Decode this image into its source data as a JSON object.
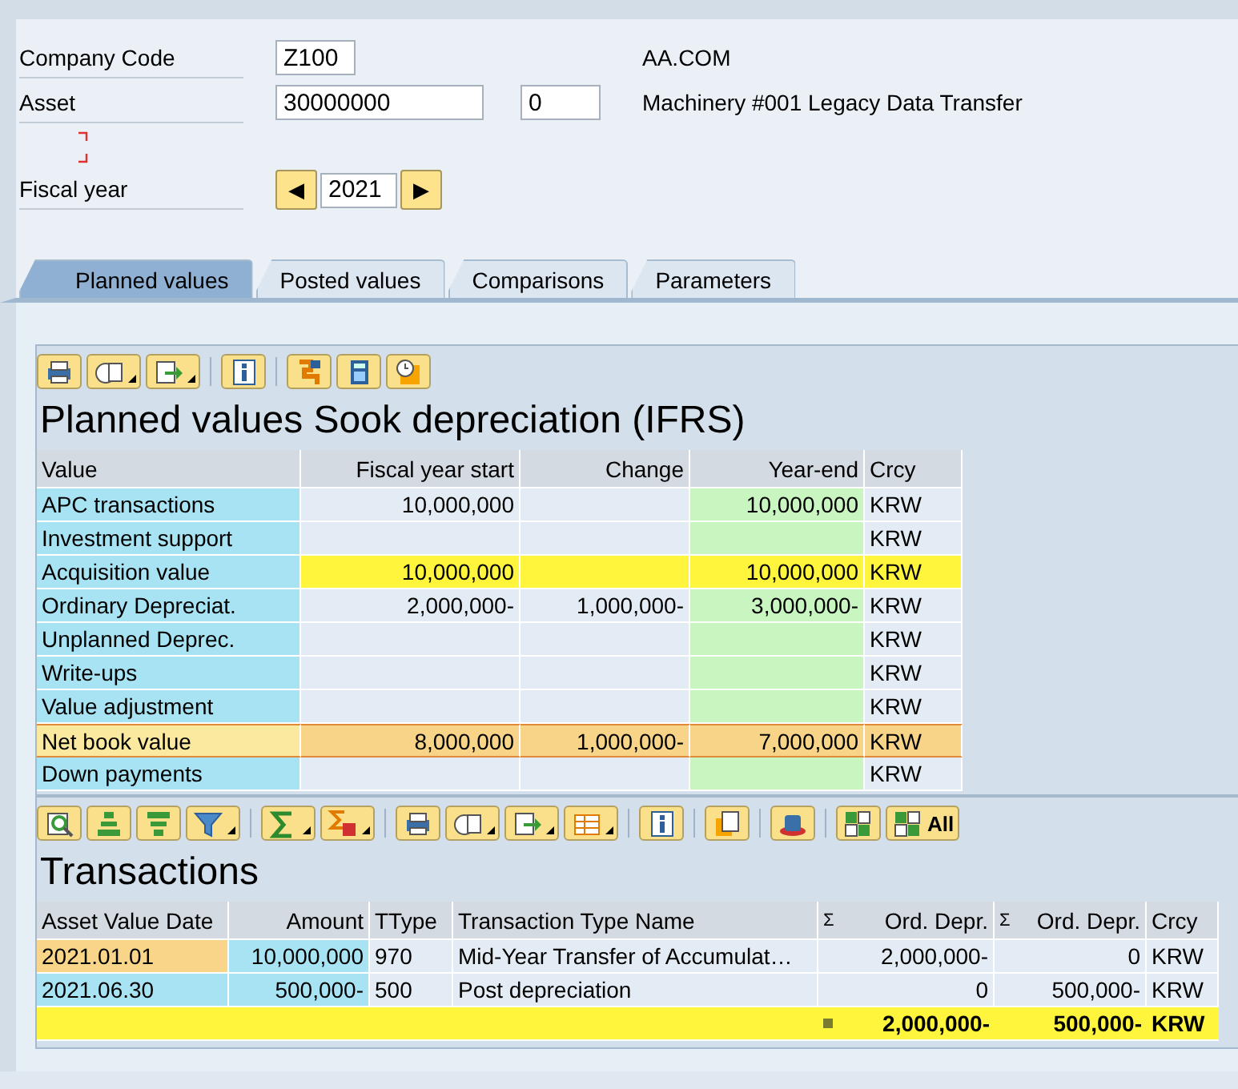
{
  "header": {
    "fields": [
      {
        "label": "Company Code",
        "value": "Z100",
        "text": "AA.COM"
      },
      {
        "label": "Asset",
        "value": "30000000",
        "extra": "0",
        "text": "Machinery #001 Legacy Data Transfer"
      }
    ],
    "fiscal_year": {
      "label": "Fiscal year",
      "prev": "◀",
      "value": "2021",
      "next": "▶"
    }
  },
  "tabs": [
    {
      "label": "Planned values",
      "selected": true
    },
    {
      "label": "Posted values",
      "selected": false
    },
    {
      "label": "Comparisons",
      "selected": false
    },
    {
      "label": "Parameters",
      "selected": false
    }
  ],
  "grids": [
    {
      "toolbar": [
        {
          "kind": "print"
        },
        {
          "kind": "view",
          "dropdown": true
        },
        {
          "kind": "export",
          "dropdown": true
        },
        {
          "kind": "sep"
        },
        {
          "kind": "info"
        },
        {
          "kind": "sep"
        },
        {
          "kind": "chart"
        },
        {
          "kind": "calc"
        },
        {
          "kind": "clock"
        }
      ],
      "title": "Planned values Sook depreciation (IFRS)",
      "columns": [
        {
          "label": "Value",
          "kind": "text"
        },
        {
          "label": "Fiscal year start",
          "kind": "number"
        },
        {
          "label": "Change",
          "kind": "number"
        },
        {
          "label": "Year-end",
          "kind": "number"
        },
        {
          "label": "Crcy",
          "kind": "text"
        }
      ],
      "rows": [
        {
          "kind": "normal",
          "cells": [
            "APC transactions",
            "10,000,000",
            null,
            "10,000,000",
            "KRW"
          ]
        },
        {
          "kind": "normal",
          "cells": [
            "Investment support",
            null,
            null,
            null,
            "KRW"
          ]
        },
        {
          "kind": "highlight",
          "cells": [
            "Acquisition value",
            "10,000,000",
            null,
            "10,000,000",
            "KRW"
          ]
        },
        {
          "kind": "normal",
          "cells": [
            "Ordinary Depreciat.",
            "2,000,000-",
            "1,000,000-",
            "3,000,000-",
            "KRW"
          ]
        },
        {
          "kind": "normal",
          "cells": [
            "Unplanned Deprec.",
            null,
            null,
            null,
            "KRW"
          ]
        },
        {
          "kind": "normal",
          "cells": [
            "Write-ups",
            null,
            null,
            null,
            "KRW"
          ]
        },
        {
          "kind": "normal",
          "cells": [
            "Value adjustment",
            null,
            null,
            null,
            "KRW"
          ]
        },
        {
          "kind": "total",
          "cells": [
            "Net book value",
            "8,000,000",
            "1,000,000-",
            "7,000,000",
            "KRW"
          ]
        },
        {
          "kind": "normal",
          "cells": [
            "Down payments",
            null,
            null,
            null,
            "KRW"
          ]
        }
      ]
    },
    {
      "toolbar": [
        {
          "kind": "details"
        },
        {
          "kind": "sortup"
        },
        {
          "kind": "sortdown"
        },
        {
          "kind": "filter",
          "dropdown": true
        },
        {
          "kind": "sep"
        },
        {
          "kind": "sum",
          "dropdown": true
        },
        {
          "kind": "subtotal",
          "dropdown": true
        },
        {
          "kind": "sep"
        },
        {
          "kind": "print"
        },
        {
          "kind": "view",
          "dropdown": true
        },
        {
          "kind": "export",
          "dropdown": true
        },
        {
          "kind": "layout",
          "dropdown": true
        },
        {
          "kind": "sep"
        },
        {
          "kind": "info"
        },
        {
          "kind": "sep"
        },
        {
          "kind": "copy"
        },
        {
          "kind": "sep"
        },
        {
          "kind": "hat"
        },
        {
          "kind": "sep"
        },
        {
          "kind": "grid"
        },
        {
          "kind": "grid",
          "label": "All"
        }
      ],
      "title": "Transactions",
      "columns": [
        {
          "label": "Asset Value Date",
          "kind": "text"
        },
        {
          "label": "Amount",
          "kind": "number"
        },
        {
          "label": "TType",
          "kind": "text"
        },
        {
          "label": "Transaction Type Name",
          "kind": "text"
        },
        {
          "label": "Ord. Depr.",
          "kind": "number",
          "mark": "Σ"
        },
        {
          "label": "Ord. Depr.",
          "kind": "number",
          "mark": "Σ"
        },
        {
          "label": "Crcy",
          "kind": "text"
        }
      ],
      "rows": [
        {
          "kind": "item",
          "selected": true,
          "cells": [
            "2021.01.01",
            "10,000,000",
            "970",
            "Mid-Year Transfer of Accumulat…",
            "2,000,000-",
            "0",
            "KRW"
          ]
        },
        {
          "kind": "item",
          "selected": false,
          "cells": [
            "2021.06.30",
            "500,000-",
            "500",
            "Post depreciation",
            "0",
            "500,000-",
            "KRW"
          ]
        },
        {
          "kind": "sum",
          "cells": [
            null,
            null,
            null,
            null,
            "2,000,000-",
            "500,000-",
            "KRW"
          ]
        }
      ]
    }
  ]
}
